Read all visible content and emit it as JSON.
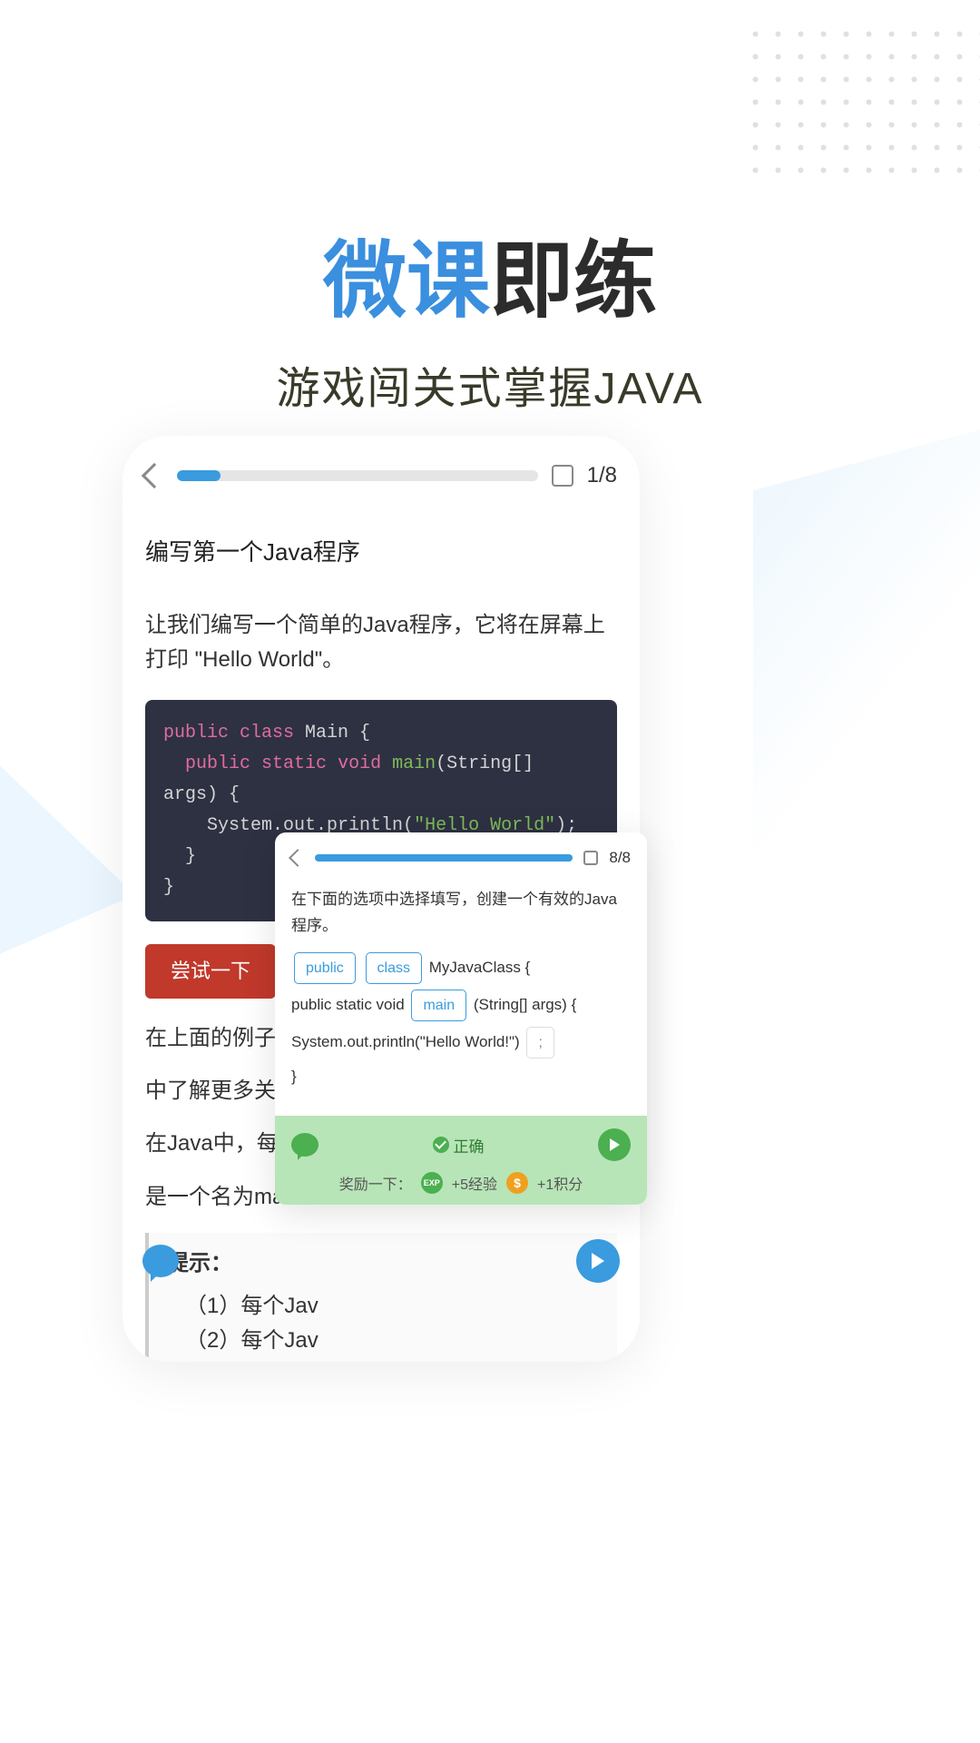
{
  "title": {
    "blue": "微课",
    "black": "即练"
  },
  "subtitle": "游戏闯关式掌握JAVA",
  "main_card": {
    "progress_percent": 12,
    "counter": "1/8",
    "lesson_title": "编写第一个Java程序",
    "lesson_desc": "让我们编写一个简单的Java程序，它将在屏幕上打印 \"Hello World\"。",
    "code": {
      "l1a": "public",
      "l1b": "class",
      "l1c": " Main {",
      "l2a": "public",
      "l2b": "static",
      "l2c": "void",
      "l2d": "main",
      "l2e": "(String[] args) {",
      "l3a": "System.out.println(",
      "l3b": "\"Hello World\"",
      "l3c": ");",
      "l4": "}",
      "l5": "}"
    },
    "try_button": "尝试一下",
    "para1": "在上面的例子中，",
    "para2": "中了解更多关于",
    "para3": "在Java中，每个",
    "para4": "是一个名为main",
    "tip_title": "提示：",
    "tip1": "（1）每个Jav",
    "tip2": "（2）每个Jav"
  },
  "overlay": {
    "progress_percent": 100,
    "counter": "8/8",
    "desc": "在下面的选项中选择填写，创建一个有效的Java程序。",
    "chip_public": "public",
    "chip_class": "class",
    "txt_myclass": " MyJavaClass {",
    "txt_line2a": "public static void ",
    "chip_main": "main",
    "txt_line2b": " (String[] args) {",
    "txt_line3": "  System.out.println(\"Hello World!\") ",
    "chip_semi": ";",
    "txt_brace": "}",
    "correct": "正确",
    "reward_label": "奖励一下：",
    "exp_text": "+5经验",
    "points_text": "+1积分",
    "exp_badge": "EXP",
    "coin_badge": "$"
  }
}
